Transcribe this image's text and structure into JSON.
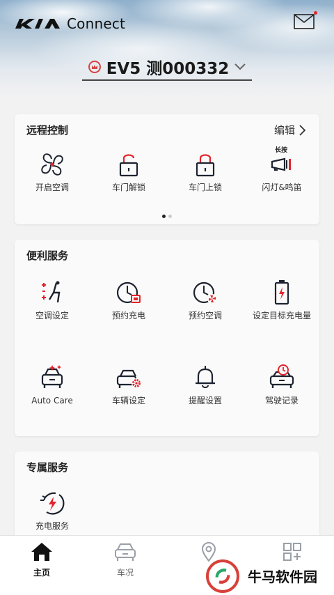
{
  "header": {
    "brand": "Connect",
    "vehicle_name": "EV5 测000332"
  },
  "remote_control": {
    "title": "远程控制",
    "edit_label": "编辑",
    "long_press_hint": "长按",
    "items": [
      {
        "label": "开启空调",
        "icon": "fan-icon"
      },
      {
        "label": "车门解锁",
        "icon": "unlock-icon"
      },
      {
        "label": "车门上锁",
        "icon": "lock-icon"
      },
      {
        "label": "闪灯&鸣笛",
        "icon": "horn-icon"
      }
    ],
    "page_count": 2,
    "active_page": 1
  },
  "convenience": {
    "title": "便利服务",
    "items": [
      {
        "label": "空调设定",
        "icon": "seat-climate-icon"
      },
      {
        "label": "预约充电",
        "icon": "scheduled-charge-icon"
      },
      {
        "label": "预约空调",
        "icon": "scheduled-climate-icon"
      },
      {
        "label": "设定目标充电量",
        "icon": "battery-target-icon"
      },
      {
        "label": "Auto Care",
        "icon": "auto-care-icon"
      },
      {
        "label": "车辆设定",
        "icon": "vehicle-settings-icon"
      },
      {
        "label": "提醒设置",
        "icon": "bell-icon"
      },
      {
        "label": "驾驶记录",
        "icon": "drive-record-icon"
      }
    ]
  },
  "exclusive": {
    "title": "专属服务",
    "items": [
      {
        "label": "充电服务",
        "icon": "charging-service-icon"
      }
    ]
  },
  "tabbar": {
    "items": [
      {
        "label": "主页",
        "icon": "home-icon",
        "active": true
      },
      {
        "label": "车况",
        "icon": "car-status-icon",
        "active": false
      },
      {
        "label": "",
        "icon": "location-icon",
        "active": false
      },
      {
        "label": "",
        "icon": "grid-plus-icon",
        "active": false
      }
    ]
  },
  "watermark": {
    "text": "牛马软件园"
  },
  "colors": {
    "accent": "#e3242b",
    "icon": "#1d2330",
    "background": "#f2f2f2"
  }
}
